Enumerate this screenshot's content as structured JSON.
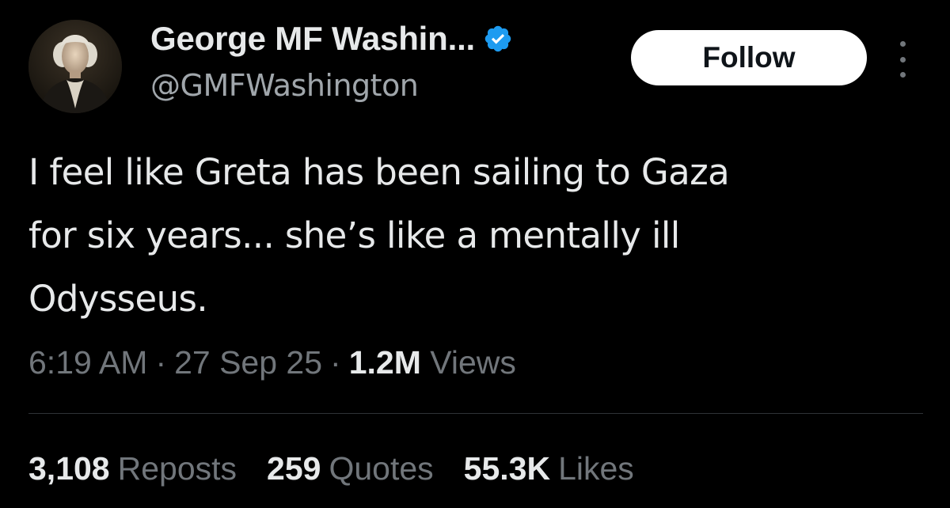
{
  "author": {
    "display_name": "George MF Washin...",
    "handle": "@GMFWashington",
    "verified_icon": "verified-badge-icon",
    "verified_color": "#1d9bf0"
  },
  "actions": {
    "follow_label": "Follow",
    "more_icon": "more-vertical-icon"
  },
  "tweet": {
    "lines": [
      "I feel like Greta has been sailing to Gaza",
      "for six years... she’s like a mentally ill",
      "Odysseus."
    ]
  },
  "meta": {
    "time": "6:19 AM",
    "separator": "·",
    "date": "27 Sep 25",
    "views_count": "1.2M",
    "views_label": "Views"
  },
  "stats": [
    {
      "count": "3,108",
      "label": "Reposts"
    },
    {
      "count": "259",
      "label": "Quotes"
    },
    {
      "count": "55.3K",
      "label": "Likes"
    }
  ],
  "colors": {
    "background": "#000000",
    "primary_text": "#e7e9ea",
    "secondary_text": "#71767b",
    "divider": "#2f3336",
    "follow_button_bg": "#ffffff"
  }
}
